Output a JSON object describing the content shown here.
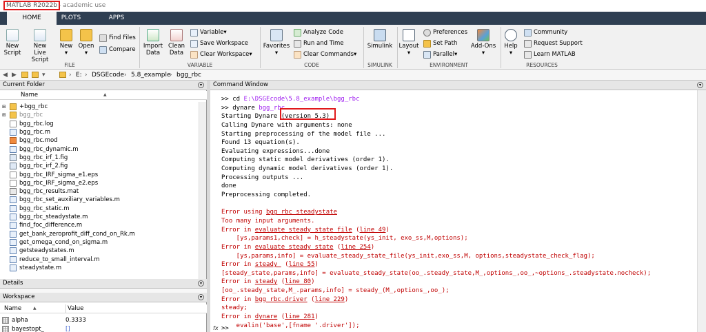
{
  "window": {
    "title_app": "MATLAB R2022b",
    "title_rest": " - academic use"
  },
  "tabs": [
    "HOME",
    "PLOTS",
    "APPS"
  ],
  "ribbon": {
    "file": {
      "new_script": [
        "New",
        "Script"
      ],
      "new_live_script": [
        "New",
        "Live Script"
      ],
      "new": "New",
      "open": "Open",
      "find_files": "Find Files",
      "compare": "Compare",
      "label": "FILE"
    },
    "variable": {
      "import_data": [
        "Import",
        "Data"
      ],
      "clean_data": [
        "Clean",
        "Data"
      ],
      "variable": "Variable",
      "save_workspace": "Save Workspace",
      "clear_workspace": "Clear Workspace",
      "label": "VARIABLE"
    },
    "code": {
      "favorites": "Favorites",
      "analyze_code": "Analyze Code",
      "run_and_time": "Run and Time",
      "clear_commands": "Clear Commands",
      "label": "CODE"
    },
    "simulink": {
      "simulink": "Simulink",
      "label": "SIMULINK"
    },
    "environment": {
      "layout": "Layout",
      "preferences": "Preferences",
      "set_path": "Set Path",
      "parallel": "Parallel",
      "add_ons": "Add-Ons",
      "label": "ENVIRONMENT"
    },
    "resources": {
      "help": "Help",
      "community": "Community",
      "request_support": "Request Support",
      "learn_matlab": "Learn MATLAB",
      "label": "RESOURCES"
    }
  },
  "address": {
    "crumbs": [
      "E:",
      "DSGEcode",
      "5.8_example",
      "bgg_rbc"
    ],
    "sep": "›"
  },
  "current_folder": {
    "title": "Current Folder",
    "col_name": "Name",
    "col_sort": "▲",
    "files": [
      "+bgg_rbc",
      "bgg_rbc",
      "bgg_rbc.log",
      "bgg_rbc.m",
      "bgg_rbc.mod",
      "bgg_rbc_dynamic.m",
      "bgg_rbc_irf_1.fig",
      "bgg_rbc_irf_2.fig",
      "bgg_rbc_IRF_sigma_e1.eps",
      "bgg_rbc_IRF_sigma_e2.eps",
      "bgg_rbc_results.mat",
      "bgg_rbc_set_auxiliary_variables.m",
      "bgg_rbc_static.m",
      "bgg_rbc_steadystate.m",
      "find_foc_difference.m",
      "get_bank_zeroprofit_diff_cond_on_Rk.m",
      "get_omega_cond_on_sigma.m",
      "getsteadystates.m",
      "reduce_to_small_interval.m",
      "steadystate.m"
    ]
  },
  "details": {
    "title": "Details"
  },
  "workspace": {
    "title": "Workspace",
    "col_name": "Name",
    "col_sort": "▲",
    "col_value": "Value",
    "vars": [
      {
        "name": "alpha",
        "value": "0.3333"
      },
      {
        "name": "bayestopt_",
        "value": "[]"
      }
    ]
  },
  "command_window": {
    "title": "Command Window",
    "prompt_fx": "fx",
    "lines": [
      [
        {
          "t": ">> cd "
        },
        {
          "t": "E:\\DSGEcode\\5.8_example\\bgg_rbc",
          "c": "purple"
        }
      ],
      [
        {
          "t": ">> dynare "
        },
        {
          "t": "bgg_rbc",
          "c": "purple"
        }
      ],
      [
        {
          "t": "Starting Dynare (version 5.3)"
        }
      ],
      [
        {
          "t": "Calling Dynare with arguments: none"
        }
      ],
      [
        {
          "t": "Starting preprocessing of the model file ..."
        }
      ],
      [
        {
          "t": "Found 13 equation(s)."
        }
      ],
      [
        {
          "t": "Evaluating expressions...done"
        }
      ],
      [
        {
          "t": "Computing static model derivatives (order 1)."
        }
      ],
      [
        {
          "t": "Computing dynamic model derivatives (order 1)."
        }
      ],
      [
        {
          "t": "Processing outputs ..."
        }
      ],
      [
        {
          "t": "done"
        }
      ],
      [
        {
          "t": "Preprocessing completed."
        }
      ],
      [
        {
          "t": ""
        }
      ],
      [
        {
          "t": "Error using ",
          "c": "red"
        },
        {
          "t": "bgg_rbc_steadystate",
          "c": "red",
          "u": 1
        }
      ],
      [
        {
          "t": "Too many input arguments.",
          "c": "red"
        }
      ],
      [
        {
          "t": "Error in ",
          "c": "red"
        },
        {
          "t": "evaluate_steady_state_file",
          "c": "red",
          "u": 1
        },
        {
          "t": " (",
          "c": "red"
        },
        {
          "t": "line 49",
          "c": "red",
          "u": 1
        },
        {
          "t": ")",
          "c": "red"
        }
      ],
      [
        {
          "t": "    [ys,params1,check] = h_steadystate(ys_init, exo_ss,M,options);",
          "c": "red"
        }
      ],
      [
        {
          "t": "Error in ",
          "c": "red"
        },
        {
          "t": "evaluate_steady_state",
          "c": "red",
          "u": 1
        },
        {
          "t": " (",
          "c": "red"
        },
        {
          "t": "line 254",
          "c": "red",
          "u": 1
        },
        {
          "t": ")",
          "c": "red"
        }
      ],
      [
        {
          "t": "    [ys,params,info] = evaluate_steady_state_file(ys_init,exo_ss,M, options,steadystate_check_flag);",
          "c": "red"
        }
      ],
      [
        {
          "t": "Error in ",
          "c": "red"
        },
        {
          "t": "steady_",
          "c": "red",
          "u": 1
        },
        {
          "t": " (",
          "c": "red"
        },
        {
          "t": "line 55",
          "c": "red",
          "u": 1
        },
        {
          "t": ")",
          "c": "red"
        }
      ],
      [
        {
          "t": "[steady_state,params,info] = evaluate_steady_state(oo_.steady_state,M_,options_,oo_,~options_.steadystate.nocheck);",
          "c": "red"
        }
      ],
      [
        {
          "t": "Error in ",
          "c": "red"
        },
        {
          "t": "steady",
          "c": "red",
          "u": 1
        },
        {
          "t": " (",
          "c": "red"
        },
        {
          "t": "line 80",
          "c": "red",
          "u": 1
        },
        {
          "t": ")",
          "c": "red"
        }
      ],
      [
        {
          "t": "[oo_.steady_state,M_.params,info] = steady_(M_,options_,oo_);",
          "c": "red"
        }
      ],
      [
        {
          "t": "Error in ",
          "c": "red"
        },
        {
          "t": "bgg_rbc.driver",
          "c": "red",
          "u": 1
        },
        {
          "t": " (",
          "c": "red"
        },
        {
          "t": "line 229",
          "c": "red",
          "u": 1
        },
        {
          "t": ")",
          "c": "red"
        }
      ],
      [
        {
          "t": "steady;",
          "c": "red"
        }
      ],
      [
        {
          "t": "Error in ",
          "c": "red"
        },
        {
          "t": "dynare",
          "c": "red",
          "u": 1
        },
        {
          "t": " (",
          "c": "red"
        },
        {
          "t": "line 281",
          "c": "red",
          "u": 1
        },
        {
          "t": ")",
          "c": "red"
        }
      ],
      [
        {
          "t": "    evalin('base',[fname '.driver']);",
          "c": "red"
        }
      ]
    ],
    "last_prompt": ">>"
  },
  "colors": {
    "tabbar": "#2f3f52",
    "error": "#c00000",
    "link": "#a020f0",
    "highlight": "#e0191b"
  }
}
